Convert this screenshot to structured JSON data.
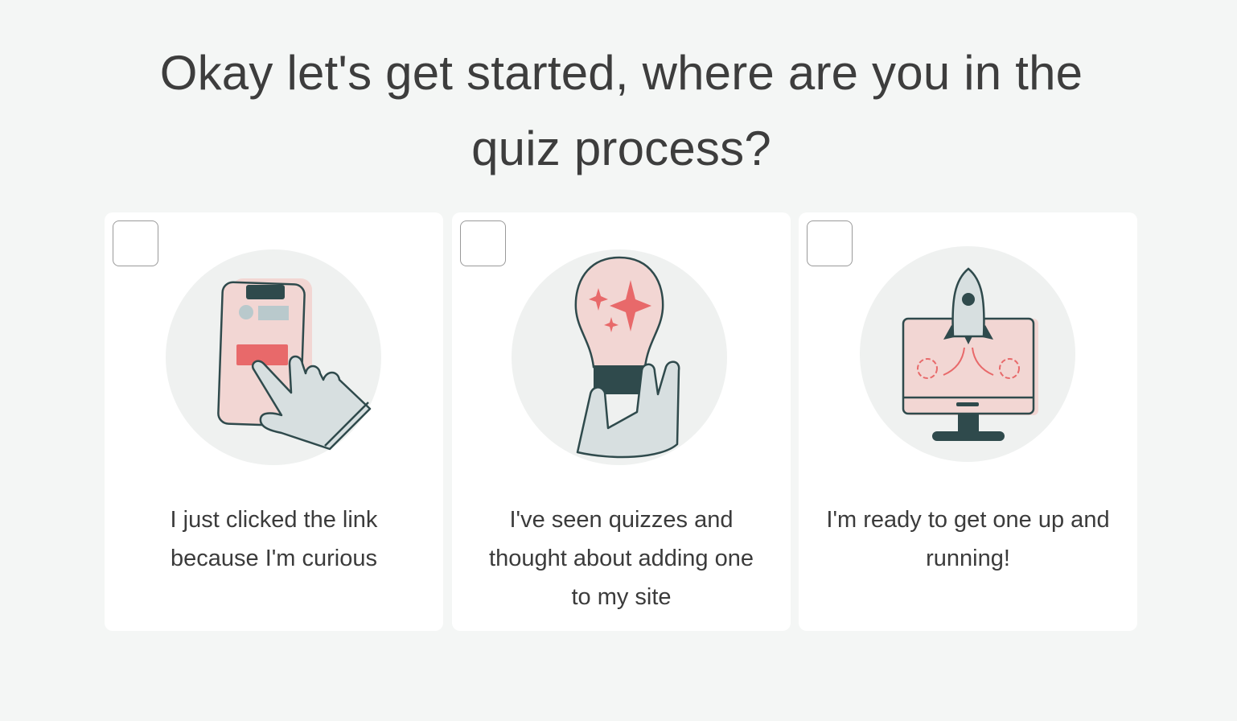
{
  "question": {
    "line1": "Okay let's get started, where are you in the",
    "line2": "quiz process?"
  },
  "options": [
    {
      "label_line1": "I just clicked the link",
      "label_line2": "because I'm curious",
      "illustration": "hand-tapping-phone-icon",
      "checked": false
    },
    {
      "label_line1": "I've seen quizzes and",
      "label_line2": "thought about adding one",
      "label_line3": "to my site",
      "illustration": "hand-holding-lightbulb-icon",
      "checked": false
    },
    {
      "label_line1": "I'm ready to get one up and",
      "label_line2": "running!",
      "illustration": "rocket-launching-from-monitor-icon",
      "checked": false
    }
  ],
  "colors": {
    "page_background": "#f4f6f5",
    "card_background": "#ffffff",
    "accent_coral": "#e8696a",
    "accent_pink": "#f2d6d3",
    "illustration_circle": "#eff1f0",
    "dark_slate": "#2f4a4c",
    "light_slate": "#d7dfe0",
    "text": "#3b3b3b"
  }
}
